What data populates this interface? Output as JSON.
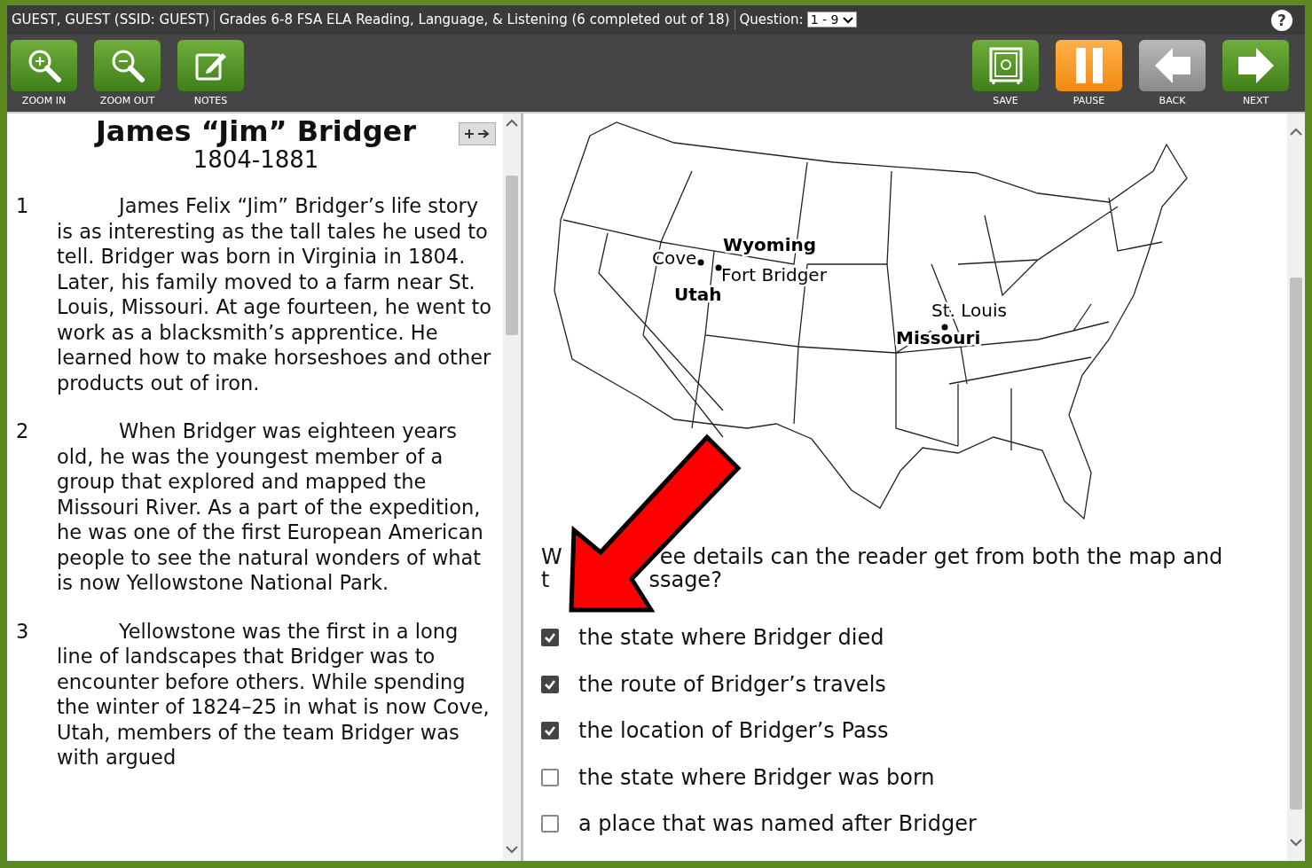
{
  "top_bar": {
    "user": "GUEST, GUEST (SSID: GUEST)",
    "test_title": "Grades 6-8 FSA ELA Reading, Language, & Listening (6 completed out of 18)",
    "question_label": "Question:",
    "question_value": "1 - 9",
    "help": "?"
  },
  "toolbar_left": [
    {
      "kind": "zoom-in",
      "label": "ZOOM IN"
    },
    {
      "kind": "zoom-out",
      "label": "ZOOM OUT"
    },
    {
      "kind": "notes",
      "label": "NOTES"
    }
  ],
  "toolbar_right": [
    {
      "kind": "save",
      "label": "SAVE"
    },
    {
      "kind": "pause",
      "label": "PAUSE"
    },
    {
      "kind": "back",
      "label": "BACK"
    },
    {
      "kind": "next",
      "label": "NEXT"
    }
  ],
  "passage": {
    "title": "James “Jim” Bridger",
    "subtitle": "1804-1881",
    "paragraphs": [
      {
        "number": "1",
        "text": "James Felix “Jim” Bridger’s life story is as interesting as the tall tales he used to tell. Bridger was born in Virginia in 1804. Later, his family moved to a farm near St. Louis, Missouri. At age fourteen, he went to work as a blacksmith’s apprentice. He learned how to make horseshoes and other products out of iron."
      },
      {
        "number": "2",
        "text": "When Bridger was eighteen years old, he was the youngest member of a group that explored and mapped the Missouri River. As a part of the expedition, he was one of the first European American people to see the natural wonders of what is now Yellowstone National Park."
      },
      {
        "number": "3",
        "text": "Yellowstone was the first in a long line of landscapes that Bridger was to encounter before others. While spending the winter of 1824–25 in what is now Cove, Utah, members of the team Bridger was with argued"
      }
    ]
  },
  "map": {
    "labels": [
      {
        "kind": "state",
        "text": "Wyoming"
      },
      {
        "kind": "city",
        "text": "Cove"
      },
      {
        "kind": "city",
        "text": "Fort Bridger"
      },
      {
        "kind": "state",
        "text": "Utah"
      },
      {
        "kind": "city",
        "text": "St. Louis"
      },
      {
        "kind": "state",
        "text": "Missouri"
      }
    ]
  },
  "question": {
    "visible_parts": [
      "W",
      "ee details can the reader get from both the map and",
      "t",
      "ssage?"
    ]
  },
  "choices": [
    {
      "text": "the state where Bridger died",
      "checked": true
    },
    {
      "text": "the route of Bridger’s travels",
      "checked": true
    },
    {
      "text": "the location of Bridger’s Pass",
      "checked": true
    },
    {
      "text": "the state where Bridger was born",
      "checked": false
    },
    {
      "text": "a place that was named after Bridger",
      "checked": false
    }
  ]
}
